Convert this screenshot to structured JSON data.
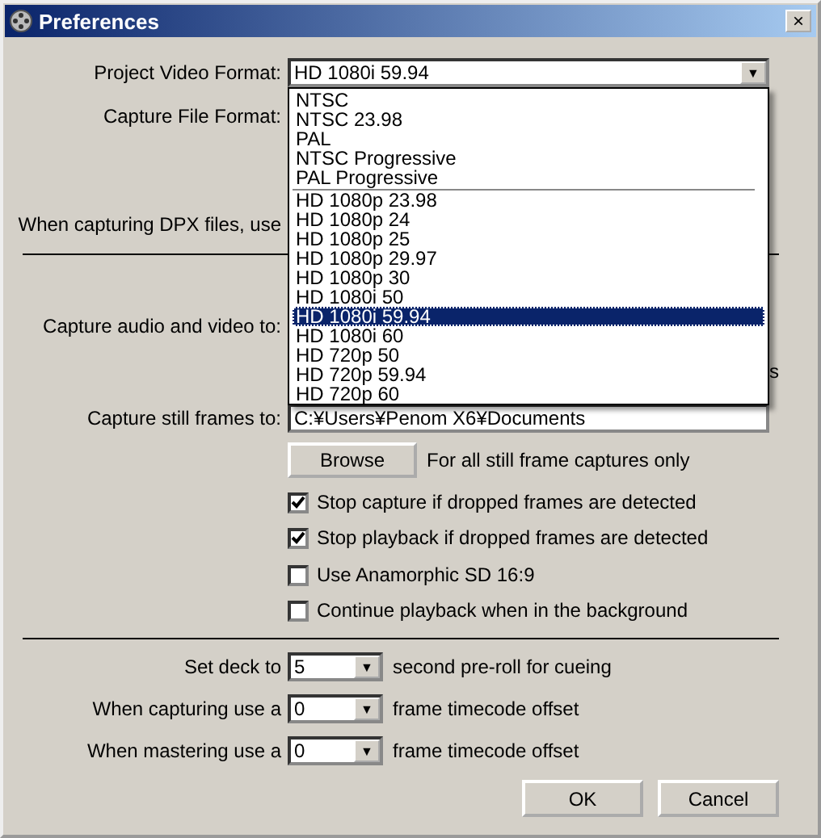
{
  "window": {
    "title": "Preferences",
    "close": "×"
  },
  "project_video_format": {
    "label": "Project Video Format:",
    "value": "HD 1080i 59.94",
    "arrow": "▼",
    "expanded": true,
    "option_groups": [
      [
        {
          "label": "NTSC",
          "selected": false
        },
        {
          "label": "NTSC 23.98",
          "selected": false
        },
        {
          "label": "PAL",
          "selected": false
        },
        {
          "label": "NTSC Progressive",
          "selected": false
        },
        {
          "label": "PAL Progressive",
          "selected": false
        }
      ],
      [
        {
          "label": "HD 1080p 23.98",
          "selected": false
        },
        {
          "label": "HD 1080p 24",
          "selected": false
        },
        {
          "label": "HD 1080p 25",
          "selected": false
        },
        {
          "label": "HD 1080p 29.97",
          "selected": false
        },
        {
          "label": "HD 1080p 30",
          "selected": false
        },
        {
          "label": "HD 1080i 50",
          "selected": false
        },
        {
          "label": "HD 1080i 59.94",
          "selected": true
        },
        {
          "label": "HD 1080i 60",
          "selected": false
        },
        {
          "label": "HD 720p 50",
          "selected": false
        },
        {
          "label": "HD 720p 59.94",
          "selected": false
        },
        {
          "label": "HD 720p 60",
          "selected": false
        }
      ]
    ]
  },
  "capture_file_format": {
    "label": "Capture File Format:"
  },
  "dpx": {
    "label": "When capturing DPX files, use"
  },
  "capture_audio_video": {
    "label": "Capture audio and video to:",
    "partial_text": "s"
  },
  "capture_still": {
    "label": "Capture still frames to:",
    "value": "C:¥Users¥Penom X6¥Documents"
  },
  "browse": {
    "button": "Browse",
    "note": "For all still frame captures only"
  },
  "checkboxes": [
    {
      "label": "Stop capture if dropped frames are detected",
      "checked": true
    },
    {
      "label": "Stop playback if dropped frames are detected",
      "checked": true
    },
    {
      "label": "Use Anamorphic SD 16:9",
      "checked": false
    },
    {
      "label": "Continue playback when in the background",
      "checked": false
    }
  ],
  "deck_rows": [
    {
      "label": "Set deck to",
      "value": "5",
      "arrow": "▼",
      "suffix": "second pre-roll for cueing"
    },
    {
      "label": "When capturing use a",
      "value": "0",
      "arrow": "▼",
      "suffix": "frame timecode offset"
    },
    {
      "label": "When mastering use a",
      "value": "0",
      "arrow": "▼",
      "suffix": "frame timecode offset"
    }
  ],
  "buttons": [
    "OK",
    "Cancel"
  ]
}
